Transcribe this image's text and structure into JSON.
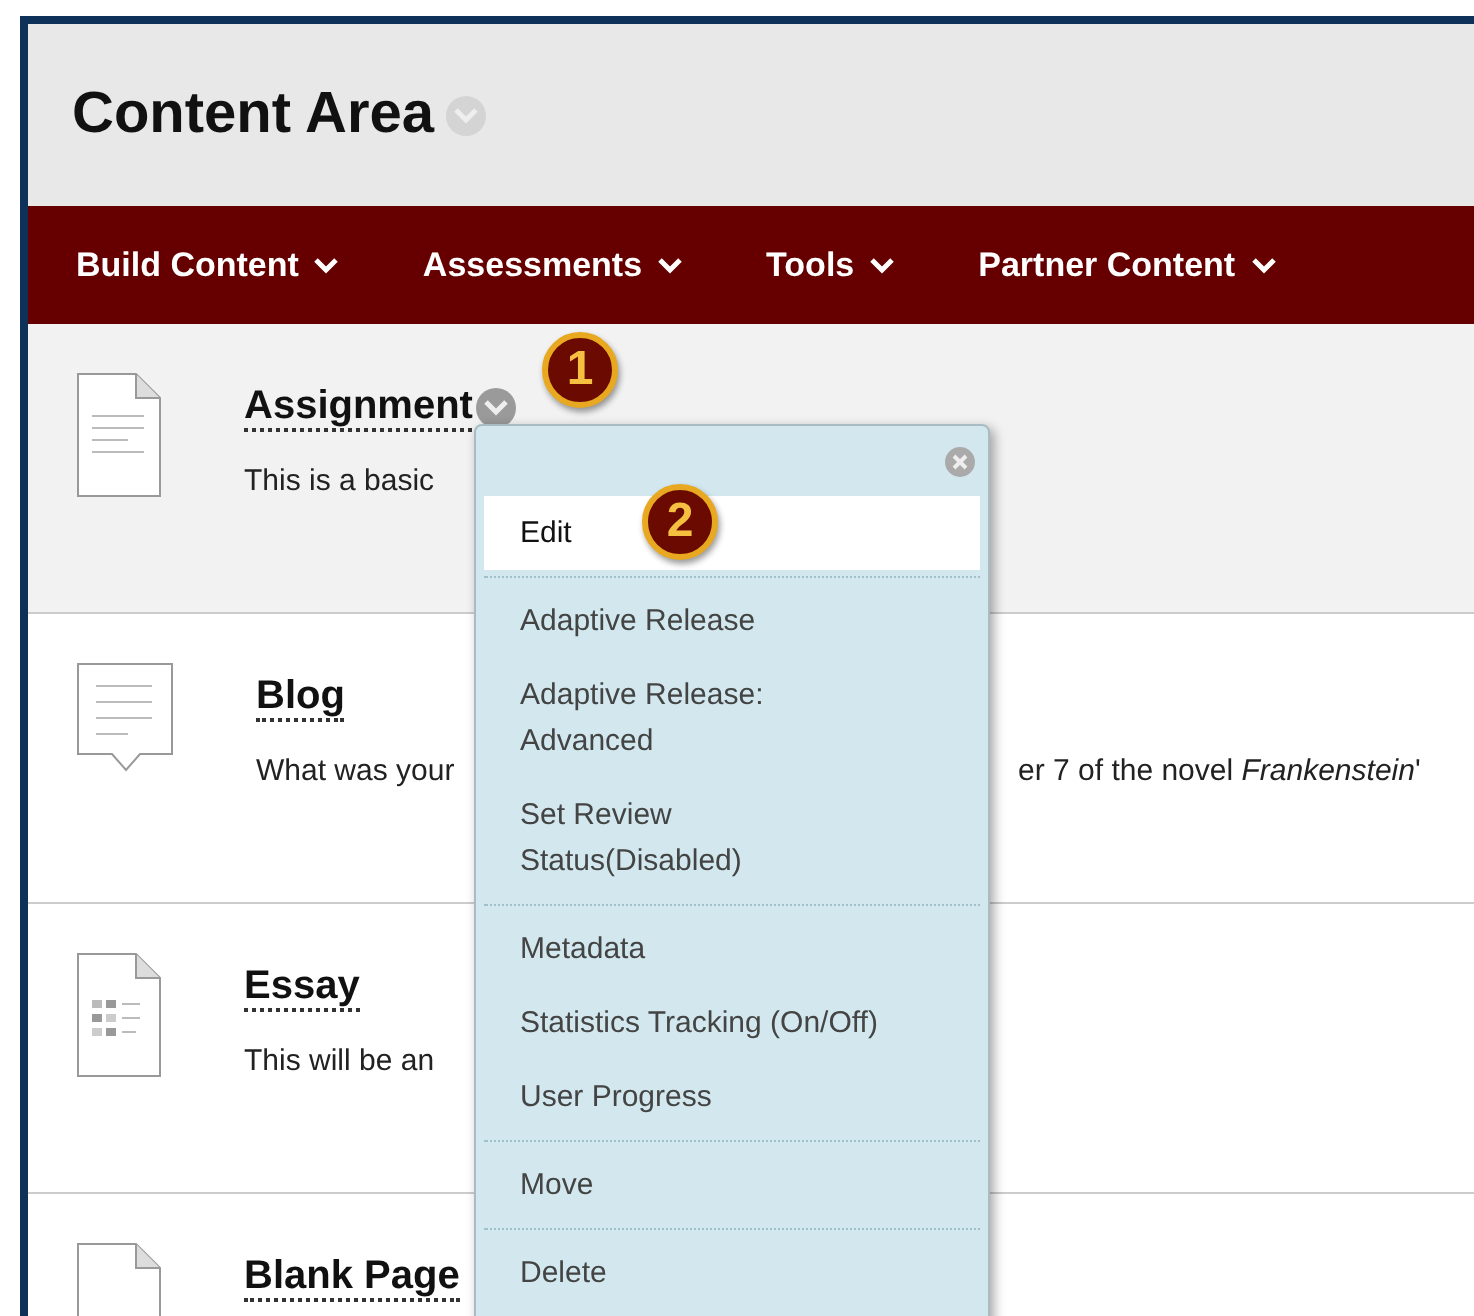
{
  "page": {
    "title": "Content Area"
  },
  "nav": [
    {
      "label": "Build Content"
    },
    {
      "label": "Assessments"
    },
    {
      "label": "Tools"
    },
    {
      "label": "Partner Content"
    }
  ],
  "items": [
    {
      "kind": "assignment",
      "title": "Assignment",
      "highlighted": true,
      "has_menu_button": true,
      "description_parts": [
        "This is a basic"
      ]
    },
    {
      "kind": "blog",
      "title": "Blog",
      "highlighted": false,
      "has_menu_button": false,
      "description_parts": [
        "What was your",
        "er 7 of the novel *Frankenstein*'"
      ]
    },
    {
      "kind": "essay",
      "title": "Essay",
      "highlighted": false,
      "has_menu_button": false,
      "description_parts": [
        "This will be an"
      ]
    },
    {
      "kind": "page",
      "title": "Blank Page",
      "highlighted": false,
      "has_menu_button": false
    }
  ],
  "menu": {
    "groups": [
      [
        {
          "label": "Edit",
          "selected": true
        }
      ],
      [
        {
          "label": "Adaptive Release",
          "selected": false
        },
        {
          "label": "Adaptive Release: Advanced",
          "selected": false
        },
        {
          "label": "Set Review Status(Disabled)",
          "selected": false
        }
      ],
      [
        {
          "label": "Metadata",
          "selected": false
        },
        {
          "label": "Statistics Tracking (On/Off)",
          "selected": false
        },
        {
          "label": "User Progress",
          "selected": false
        }
      ],
      [
        {
          "label": "Move",
          "selected": false
        }
      ],
      [
        {
          "label": "Delete",
          "selected": false
        }
      ]
    ]
  },
  "callouts": [
    "1",
    "2"
  ]
}
